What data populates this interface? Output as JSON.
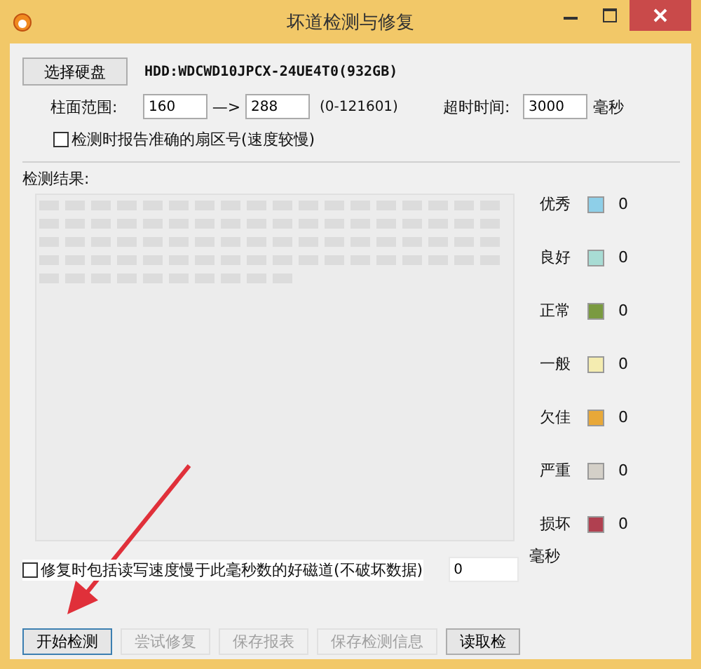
{
  "window": {
    "title": "坏道检测与修复"
  },
  "disk": {
    "button": "选择硬盘",
    "name": "HDD:WDCWD10JPCX-24UE4T0(932GB)"
  },
  "range": {
    "label": "柱面范围:",
    "from": "160",
    "arrow": "—>",
    "to": "288",
    "hint": "(0-121601)"
  },
  "timeout": {
    "label": "超时时间:",
    "value": "3000",
    "unit": "毫秒"
  },
  "report_sector": {
    "label": "检测时报告准确的扇区号(速度较慢)",
    "checked": false
  },
  "results": {
    "label": "检测结果:"
  },
  "legend": [
    {
      "label": "优秀",
      "color": "#8ecfe8",
      "count": "0"
    },
    {
      "label": "良好",
      "color": "#a8dcd4",
      "count": "0"
    },
    {
      "label": "正常",
      "color": "#7a9a40",
      "count": "0"
    },
    {
      "label": "一般",
      "color": "#f4ecb0",
      "count": "0"
    },
    {
      "label": "欠佳",
      "color": "#e8a838",
      "count": "0"
    },
    {
      "label": "严重",
      "color": "#d4d0c8",
      "count": "0"
    },
    {
      "label": "损坏",
      "color": "#b04050",
      "count": "0"
    }
  ],
  "repair_slow": {
    "label": "修复时包括读写速度慢于此毫秒数的好磁道(不破坏数据)",
    "checked": false,
    "value": "0",
    "unit": "毫秒"
  },
  "buttons": [
    {
      "label": "开始检测",
      "disabled": false
    },
    {
      "label": "尝试修复",
      "disabled": true
    },
    {
      "label": "保存报表",
      "disabled": true
    },
    {
      "label": "保存检测信息",
      "disabled": true
    },
    {
      "label": "读取检",
      "disabled": false
    }
  ]
}
